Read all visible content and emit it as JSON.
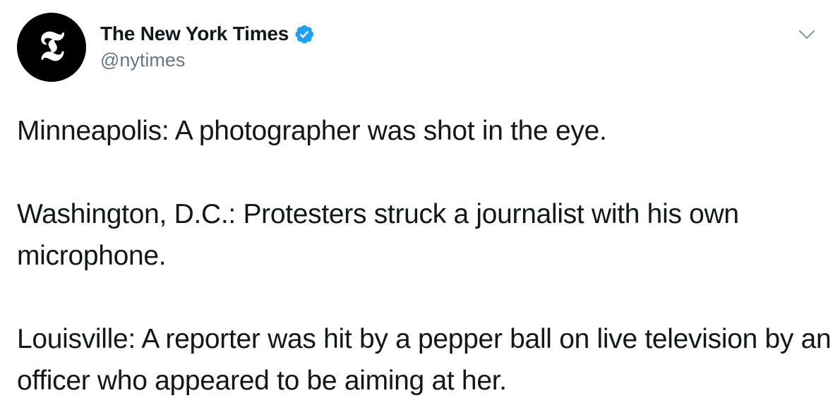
{
  "account": {
    "display_name": "The New York Times",
    "handle": "@nytimes",
    "avatar_glyph": "𝕿",
    "verified_color": "#1da1f2",
    "icons": {
      "verified": "verified-badge-icon",
      "menu": "chevron-down-icon"
    }
  },
  "tweet": {
    "paragraphs": [
      "Minneapolis: A photographer was shot in the eye.",
      "Washington, D.C.: Protesters struck a journalist with his own microphone.",
      "Louisville: A reporter was hit by a pepper ball on live television by an officer who appeared to be aiming at her."
    ]
  },
  "colors": {
    "text": "#14171a",
    "secondary_text": "#657786",
    "background": "#ffffff"
  }
}
